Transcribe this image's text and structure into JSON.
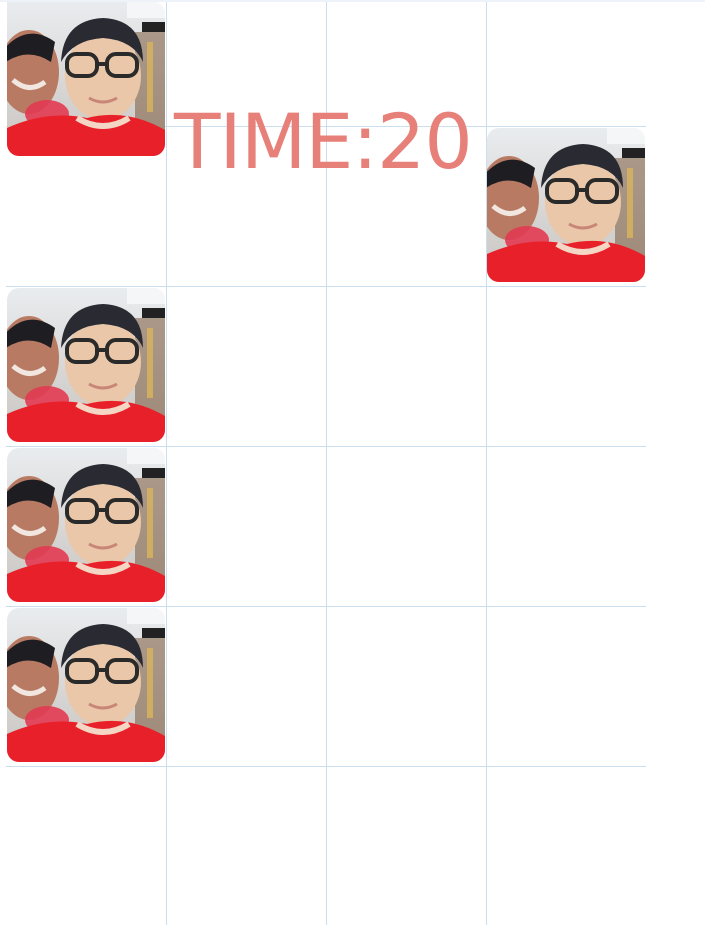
{
  "timer": {
    "label": "TIME:",
    "value": "20",
    "text": "TIME:20"
  },
  "grid": {
    "columns": 4,
    "rows": 6
  },
  "tiles": [
    {
      "row": 0,
      "col": 0,
      "image": "family-photo-tile"
    },
    {
      "row": 1,
      "col": 3,
      "image": "family-photo-tile"
    },
    {
      "row": 2,
      "col": 0,
      "image": "family-photo-tile"
    },
    {
      "row": 3,
      "col": 0,
      "image": "family-photo-tile"
    },
    {
      "row": 4,
      "col": 0,
      "image": "family-photo-tile"
    }
  ],
  "colors": {
    "timer": "#e8807a",
    "grid_line": "#c9dff0",
    "shirt_red": "#e8202a"
  }
}
